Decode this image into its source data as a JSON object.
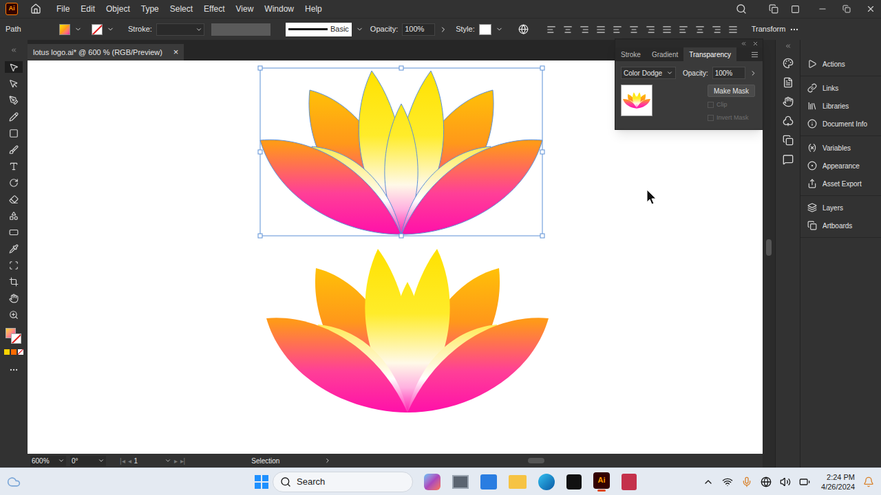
{
  "app_logo": "Ai",
  "menu": [
    "File",
    "Edit",
    "Object",
    "Type",
    "Select",
    "Effect",
    "View",
    "Window",
    "Help"
  ],
  "control_bar": {
    "object_type": "Path",
    "stroke_label": "Stroke:",
    "brush": "Basic",
    "opacity_label": "Opacity:",
    "opacity": "100%",
    "style_label": "Style:",
    "transform": "Transform"
  },
  "document_tab": {
    "title": "lotus logo.ai* @ 600 % (RGB/Preview)",
    "close": "×"
  },
  "artworks": [
    {
      "name": "lotus-top",
      "selected": true
    },
    {
      "name": "lotus-bottom",
      "selected": false
    }
  ],
  "transparency_panel": {
    "tabs": [
      {
        "label": "Stroke",
        "selected": false
      },
      {
        "label": "Gradient",
        "selected": false
      },
      {
        "label": "Transparency",
        "selected": true
      }
    ],
    "blend_mode": "Color Dodge",
    "opacity_label": "Opacity:",
    "opacity": "100%",
    "make_mask": "Make Mask",
    "options": [
      {
        "label": "Clip",
        "checked": false,
        "disabled": true
      },
      {
        "label": "Invert Mask",
        "checked": false,
        "disabled": true
      }
    ]
  },
  "panel_groups": [
    [
      "Actions"
    ],
    [
      "Links",
      "Libraries",
      "Document Info"
    ],
    [
      "Variables",
      "Appearance",
      "Asset Export"
    ],
    [
      "Layers",
      "Artboards"
    ]
  ],
  "status_bar": {
    "zoom": "600%",
    "rotation": "0°",
    "artboard": "1",
    "tool": "Selection"
  },
  "taskbar": {
    "search": "Search",
    "time": "2:24 PM",
    "date": "4/26/2024"
  }
}
